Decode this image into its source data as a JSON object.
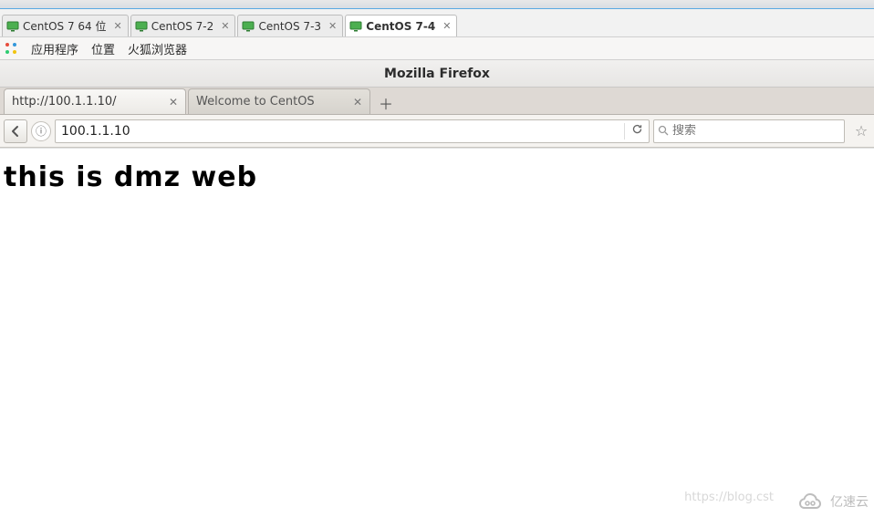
{
  "vm_tabs": [
    {
      "label": "CentOS 7 64 位",
      "active": false
    },
    {
      "label": "CentOS 7-2",
      "active": false
    },
    {
      "label": "CentOS 7-3",
      "active": false
    },
    {
      "label": "CentOS 7-4",
      "active": true
    }
  ],
  "menubar": {
    "apps": "应用程序",
    "places": "位置",
    "firefox": "火狐浏览器"
  },
  "window_title": "Mozilla Firefox",
  "browser_tabs": [
    {
      "label": "http://100.1.1.10/",
      "active": true
    },
    {
      "label": "Welcome to CentOS",
      "active": false
    }
  ],
  "toolbar": {
    "url_value": "100.1.1.10",
    "search_placeholder": "搜索"
  },
  "page": {
    "heading": "this is dmz web"
  },
  "watermark": {
    "faded_url": "https://blog.cst",
    "brand": "亿速云"
  }
}
